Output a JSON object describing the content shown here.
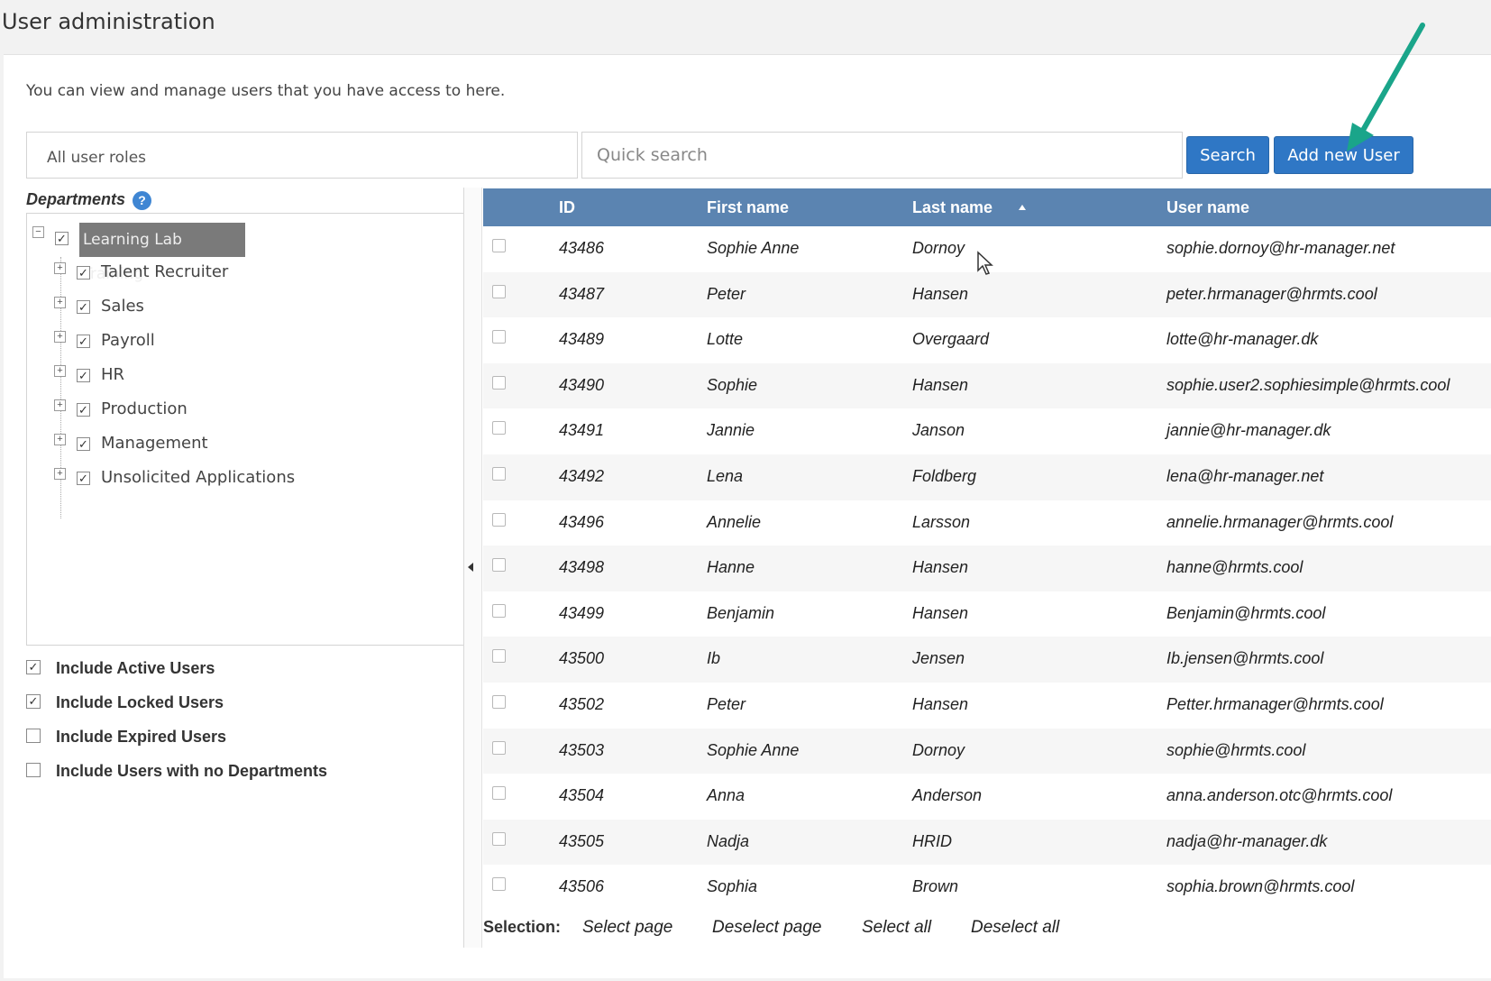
{
  "page_title": "User administration",
  "intro_text": "You can view and manage users that you have access to here.",
  "filters": {
    "role_select_value": "All user roles",
    "search_placeholder": "Quick search",
    "search_button": "Search",
    "add_button": "Add new User"
  },
  "departments": {
    "label": "Departments",
    "help_icon": "?",
    "root": {
      "label": "Learning Lab Training",
      "checked": true,
      "expanded": true
    },
    "items": [
      {
        "label": "Talent Recruiter",
        "checked": true
      },
      {
        "label": "Sales",
        "checked": true
      },
      {
        "label": "Payroll",
        "checked": true
      },
      {
        "label": "HR",
        "checked": true
      },
      {
        "label": "Production",
        "checked": true
      },
      {
        "label": "Management",
        "checked": true
      },
      {
        "label": "Unsolicited Applications",
        "checked": true
      }
    ]
  },
  "options": [
    {
      "label": "Include Active Users",
      "checked": true
    },
    {
      "label": "Include Locked Users",
      "checked": true
    },
    {
      "label": "Include Expired Users",
      "checked": false
    },
    {
      "label": "Include Users with no Departments",
      "checked": false
    }
  ],
  "table": {
    "columns": {
      "id": "ID",
      "first_name": "First name",
      "last_name": "Last name",
      "user_name": "User name"
    },
    "sorted_by": "last_name",
    "sort_direction": "ascending",
    "rows": [
      {
        "id": "43486",
        "first": "Sophie Anne",
        "last": "Dornoy",
        "user": "sophie.dornoy@hr-manager.net"
      },
      {
        "id": "43487",
        "first": "Peter",
        "last": "Hansen",
        "user": "peter.hrmanager@hrmts.cool"
      },
      {
        "id": "43489",
        "first": "Lotte",
        "last": "Overgaard",
        "user": "lotte@hr-manager.dk"
      },
      {
        "id": "43490",
        "first": "Sophie",
        "last": "Hansen",
        "user": "sophie.user2.sophiesimple@hrmts.cool"
      },
      {
        "id": "43491",
        "first": "Jannie",
        "last": "Janson",
        "user": "jannie@hr-manager.dk"
      },
      {
        "id": "43492",
        "first": "Lena",
        "last": "Foldberg",
        "user": "lena@hr-manager.net"
      },
      {
        "id": "43496",
        "first": "Annelie",
        "last": "Larsson",
        "user": "annelie.hrmanager@hrmts.cool"
      },
      {
        "id": "43498",
        "first": "Hanne",
        "last": "Hansen",
        "user": "hanne@hrmts.cool"
      },
      {
        "id": "43499",
        "first": "Benjamin",
        "last": "Hansen",
        "user": "Benjamin@hrmts.cool"
      },
      {
        "id": "43500",
        "first": "Ib",
        "last": "Jensen",
        "user": "Ib.jensen@hrmts.cool"
      },
      {
        "id": "43502",
        "first": "Peter",
        "last": "Hansen",
        "user": "Petter.hrmanager@hrmts.cool"
      },
      {
        "id": "43503",
        "first": "Sophie Anne",
        "last": "Dornoy",
        "user": "sophie@hrmts.cool"
      },
      {
        "id": "43504",
        "first": "Anna",
        "last": "Anderson",
        "user": "anna.anderson.otc@hrmts.cool"
      },
      {
        "id": "43505",
        "first": "Nadja",
        "last": "HRID",
        "user": "nadja@hr-manager.dk"
      },
      {
        "id": "43506",
        "first": "Sophia",
        "last": "Brown",
        "user": "sophia.brown@hrmts.cool"
      }
    ]
  },
  "selection": {
    "label": "Selection:",
    "select_page": "Select page",
    "deselect_page": "Deselect page",
    "select_all": "Select all",
    "deselect_all": "Deselect all"
  },
  "colors": {
    "header_bg": "#5b84b1",
    "button_bg": "#2f77c5",
    "annotation_arrow": "#1aa58a"
  },
  "icons": {
    "help": "help-icon",
    "sort": "sort-ascending-icon",
    "collapse": "tree-collapse-icon",
    "expand": "tree-expand-icon",
    "check": "checkmark-icon",
    "splitter": "collapse-left-icon",
    "cursor": "mouse-pointer-icon",
    "annotation": "annotation-arrow-icon"
  }
}
